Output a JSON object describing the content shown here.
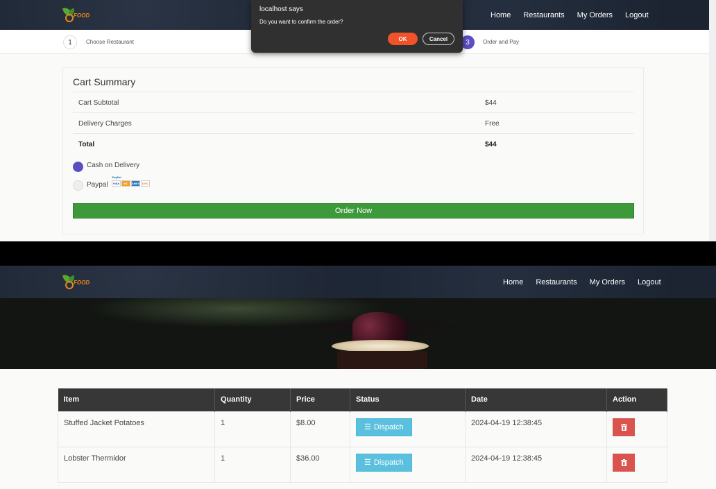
{
  "header": {
    "logo_text": "FOOD",
    "nav": [
      "Home",
      "Restaurants",
      "My Orders",
      "Logout"
    ]
  },
  "steps": {
    "step1_number": "1",
    "step1_label": "Choose Restaurant",
    "step3_number": "3",
    "step3_label": "Order and Pay"
  },
  "cart": {
    "title": "Cart Summary",
    "rows": [
      {
        "label": "Cart Subtotal",
        "value": "$44"
      },
      {
        "label": "Delivery Charges",
        "value": "Free"
      },
      {
        "label": "Total",
        "value": "$44"
      }
    ],
    "payment_options": [
      {
        "label": "Cash on Delivery",
        "selected": true
      },
      {
        "label": "Paypal",
        "selected": false
      }
    ],
    "paypal_logos": [
      "PayPal",
      "VISA",
      "MC",
      "AMEX",
      "DISC"
    ],
    "order_button": "Order Now"
  },
  "dialog": {
    "title": "localhost says",
    "message": "Do you want to confirm the order?",
    "ok_label": "OK",
    "cancel_label": "Cancel"
  },
  "orders": {
    "columns": [
      "Item",
      "Quantity",
      "Price",
      "Status",
      "Date",
      "Action"
    ],
    "rows": [
      {
        "item": "Stuffed Jacket Potatoes",
        "quantity": "1",
        "price": "$8.00",
        "status": "Dispatch",
        "date": "2024-04-19 12:38:45"
      },
      {
        "item": "Lobster Thermidor",
        "quantity": "1",
        "price": "$36.00",
        "status": "Dispatch",
        "date": "2024-04-19 12:38:45"
      }
    ]
  },
  "colors": {
    "navbar": "#1c2432",
    "accent_purple": "#5b4ec0",
    "order_green": "#3d9a3a",
    "dispatch_blue": "#5bc0de",
    "delete_red": "#d9534f",
    "dialog_ok": "#f0522a"
  },
  "icons": {
    "dispatch": "list-icon",
    "delete": "trash-icon"
  }
}
